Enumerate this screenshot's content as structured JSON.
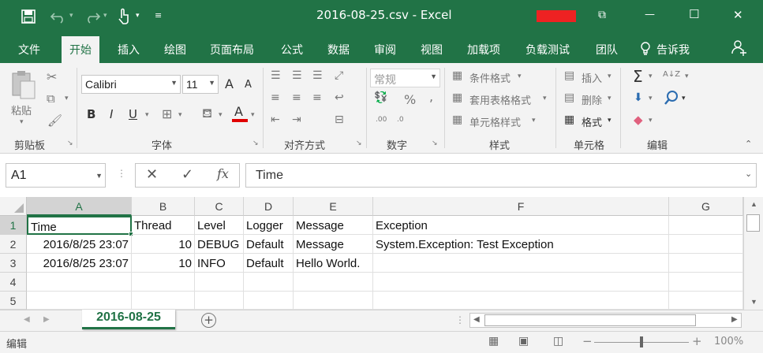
{
  "window": {
    "title": "2016-08-25.csv - Excel",
    "controls": {
      "restore_ribbon": "⧉",
      "minimize": "—",
      "maximize": "☐",
      "close": "✕"
    }
  },
  "qat": {
    "save_icon": "save-icon",
    "undo_icon": "undo-icon",
    "redo_icon": "redo-icon",
    "touch_icon": "touch-mode-icon",
    "customize_icon": "customize-icon"
  },
  "tabs": [
    "文件",
    "开始",
    "插入",
    "绘图",
    "页面布局",
    "公式",
    "数据",
    "审阅",
    "视图",
    "加载项",
    "负载测试",
    "团队",
    "告诉我"
  ],
  "ribbon": {
    "clipboard": {
      "label": "剪贴板",
      "paste": "粘贴"
    },
    "font": {
      "label": "字体",
      "name": "Calibri",
      "size": "11",
      "bold": "B",
      "italic": "I",
      "underline": "U",
      "grow": "A",
      "shrink": "A",
      "font_color": "A"
    },
    "alignment": {
      "label": "对齐方式"
    },
    "number": {
      "label": "数字",
      "format": "常规",
      "percent": "%",
      "comma": ",",
      "inc": ".00",
      "dec": ".0"
    },
    "styles": {
      "label": "样式",
      "conditional": "条件格式",
      "table": "套用表格格式",
      "cell": "单元格样式"
    },
    "cells": {
      "label": "单元格",
      "insert": "插入",
      "delete": "删除",
      "format": "格式"
    },
    "editing": {
      "label": "编辑",
      "sum": "Σ",
      "sort": "A↓Z",
      "find": "⚲"
    }
  },
  "formula_bar": {
    "name_box": "A1",
    "cancel": "✕",
    "enter": "✓",
    "fx": "fx",
    "content": "Time"
  },
  "grid": {
    "columns": [
      "A",
      "B",
      "C",
      "D",
      "E",
      "F",
      "G"
    ],
    "rows": [
      "1",
      "2",
      "3",
      "4",
      "5"
    ],
    "cells": [
      [
        "Time",
        "Thread",
        "Level",
        "Logger",
        "Message",
        "Exception",
        ""
      ],
      [
        "2016/8/25 23:07",
        "10",
        "DEBUG",
        "Default",
        "Message",
        "System.Exception: Test Exception",
        ""
      ],
      [
        "2016/8/25 23:07",
        "10",
        "INFO",
        "Default",
        "Hello World.",
        "",
        ""
      ],
      [
        "",
        "",
        "",
        "",
        "",
        "",
        ""
      ],
      [
        "",
        "",
        "",
        "",
        "",
        "",
        ""
      ]
    ]
  },
  "sheets": {
    "active": "2016-08-25",
    "add": "+"
  },
  "status": {
    "mode": "编辑",
    "zoom": "100%",
    "zoom_minus": "−",
    "zoom_plus": "+"
  },
  "colors": {
    "accent": "#217346",
    "redacted": "#ee2222"
  }
}
